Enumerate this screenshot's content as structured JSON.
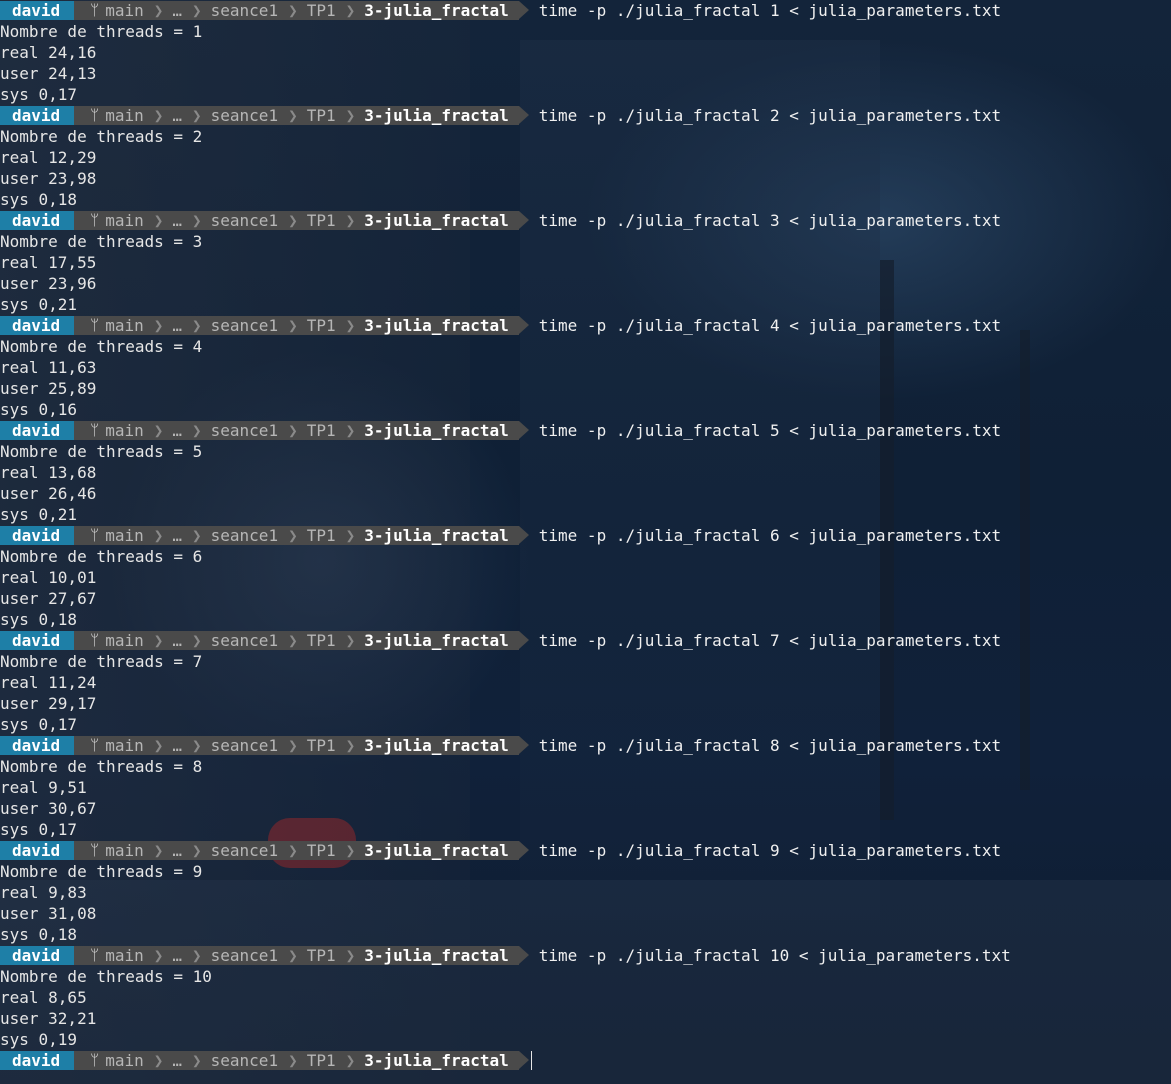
{
  "prompt": {
    "user": "david",
    "branch": "main",
    "ellipsis": "…",
    "crumbs": [
      "seance1",
      "TP1"
    ],
    "current_dir": "3-julia_fractal"
  },
  "runs": [
    {
      "cmd": "time -p ./julia_fractal 1 < julia_parameters.txt",
      "out": [
        "Nombre de threads = 1",
        "real 24,16",
        "user 24,13",
        "sys 0,17"
      ]
    },
    {
      "cmd": "time -p ./julia_fractal 2 < julia_parameters.txt",
      "out": [
        "Nombre de threads = 2",
        "real 12,29",
        "user 23,98",
        "sys 0,18"
      ]
    },
    {
      "cmd": "time -p ./julia_fractal 3 < julia_parameters.txt",
      "out": [
        "Nombre de threads = 3",
        "real 17,55",
        "user 23,96",
        "sys 0,21"
      ]
    },
    {
      "cmd": "time -p ./julia_fractal 4 < julia_parameters.txt",
      "out": [
        "Nombre de threads = 4",
        "real 11,63",
        "user 25,89",
        "sys 0,16"
      ]
    },
    {
      "cmd": "time -p ./julia_fractal 5 < julia_parameters.txt",
      "out": [
        "Nombre de threads = 5",
        "real 13,68",
        "user 26,46",
        "sys 0,21"
      ]
    },
    {
      "cmd": "time -p ./julia_fractal 6 < julia_parameters.txt",
      "out": [
        "Nombre de threads = 6",
        "real 10,01",
        "user 27,67",
        "sys 0,18"
      ]
    },
    {
      "cmd": "time -p ./julia_fractal 7 < julia_parameters.txt",
      "out": [
        "Nombre de threads = 7",
        "real 11,24",
        "user 29,17",
        "sys 0,17"
      ]
    },
    {
      "cmd": "time -p ./julia_fractal 8 < julia_parameters.txt",
      "out": [
        "Nombre de threads = 8",
        "real 9,51",
        "user 30,67",
        "sys 0,17"
      ]
    },
    {
      "cmd": "time -p ./julia_fractal 9 < julia_parameters.txt",
      "out": [
        "Nombre de threads = 9",
        "real 9,83",
        "user 31,08",
        "sys 0,18"
      ]
    },
    {
      "cmd": "time -p ./julia_fractal 10 < julia_parameters.txt",
      "out": [
        "Nombre de threads = 10",
        "real 8,65",
        "user 32,21",
        "sys 0,19"
      ]
    }
  ],
  "final_prompt_cmd": ""
}
